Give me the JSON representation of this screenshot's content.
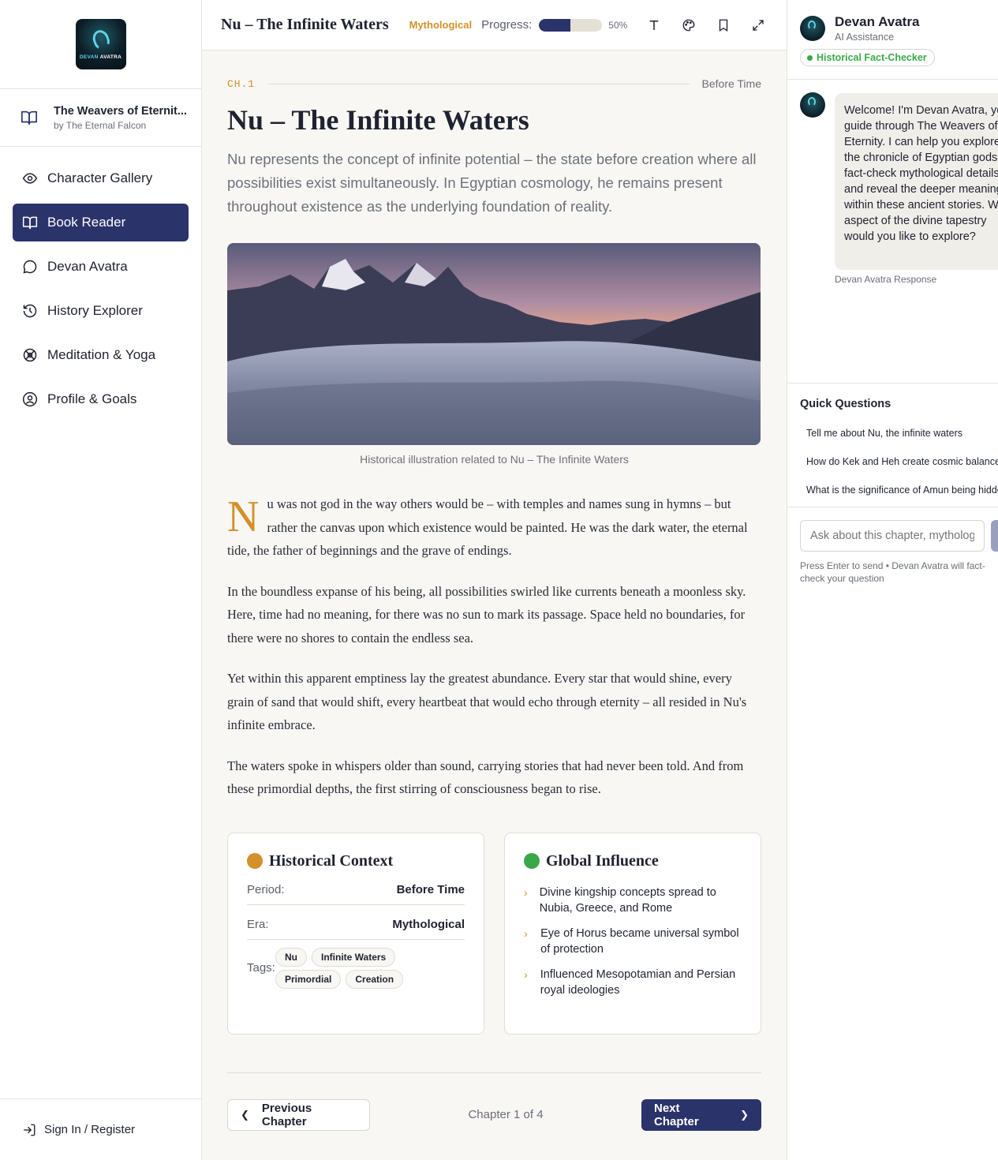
{
  "app": {
    "logo_text_a": "DEVAN",
    "logo_text_b": "AVATRA"
  },
  "sidebar": {
    "book_title": "The Weavers of Eternit...",
    "book_author": "by The Eternal Falcon",
    "items": [
      {
        "label": "Character Gallery",
        "icon": "eye-icon",
        "active": false
      },
      {
        "label": "Book Reader",
        "icon": "book-open-icon",
        "active": true
      },
      {
        "label": "Devan Avatra",
        "icon": "chat-bubble-icon",
        "active": false
      },
      {
        "label": "History Explorer",
        "icon": "history-icon",
        "active": false
      },
      {
        "label": "Meditation & Yoga",
        "icon": "lotus-icon",
        "active": false
      },
      {
        "label": "Profile & Goals",
        "icon": "user-circle-icon",
        "active": false
      }
    ],
    "sign_in": "Sign In / Register"
  },
  "topbar": {
    "title": "Nu – The Infinite Waters",
    "era": "Mythological",
    "progress_label": "Progress:",
    "progress_value": 0.5,
    "progress_pct": "50%",
    "tools": [
      "text-size-icon",
      "palette-icon",
      "bookmark-icon",
      "expand-icon"
    ]
  },
  "chapter": {
    "code": "CH.1",
    "period": "Before Time",
    "heading": "Nu – The Infinite Waters",
    "summary": "Nu represents the concept of infinite potential – the state before creation where all possibilities exist simultaneously. In Egyptian cosmology, he remains present throughout existence as the underlying foundation of reality.",
    "image_caption": "Historical illustration related to Nu – The Infinite Waters",
    "dropcap": "N",
    "paragraph_1": "u was not god in the way others would be – with temples and names sung in hymns – but rather the canvas upon which existence would be painted. He was the dark water, the eternal tide, the father of beginnings and the grave of endings.",
    "paragraph_2": "In the boundless expanse of his being, all possibilities swirled like currents beneath a moonless sky. Here, time had no meaning, for there was no sun to mark its passage. Space held no boundaries, for there were no shores to contain the endless sea.",
    "paragraph_3": "Yet within this apparent emptiness lay the greatest abundance. Every star that would shine, every grain of sand that would shift, every heartbeat that would echo through eternity – all resided in Nu's infinite embrace.",
    "paragraph_4": "The waters spoke in whispers older than sound, carrying stories that had never been told. And from these primordial depths, the first stirring of consciousness began to rise."
  },
  "context_card": {
    "title": "Historical Context",
    "dot_color": "#d4902a",
    "period_label": "Period:",
    "period_value": "Before Time",
    "era_label": "Era:",
    "era_value": "Mythological",
    "tags_label": "Tags:",
    "tags": [
      "Nu",
      "Infinite Waters",
      "Primordial",
      "Creation"
    ]
  },
  "influence_card": {
    "title": "Global Influence",
    "dot_color": "#3aa84a",
    "items": [
      "Divine kingship concepts spread to Nubia, Greece, and Rome",
      "Eye of Horus became universal symbol of protection",
      "Influenced Mesopotamian and Persian royal ideologies"
    ]
  },
  "chapter_nav": {
    "prev": "Previous Chapter",
    "count": "Chapter 1 of 4",
    "next": "Next Chapter"
  },
  "assistant": {
    "name": "Devan Avatra",
    "subtitle": "AI Assistance",
    "badge": "Historical Fact-Checker",
    "welcome": "Welcome! I'm Devan Avatra, your guide through The Weavers of Eternity. I can help you explore the chronicle of Egyptian gods, fact-check mythological details, and reveal the deeper meanings within these ancient stories. What aspect of the divine tapestry would you like to explore?",
    "response_meta": "Devan Avatra Response",
    "quick_title": "Quick Questions",
    "quick_questions": [
      "Tell me about Nu, the infinite waters",
      "How do Kek and Heh create cosmic balance?",
      "What is the significance of Amun being hidden?"
    ],
    "input_placeholder": "Ask about this chapter, mythology...",
    "hint": "Press Enter to send • Devan Avatra will fact-check your question"
  }
}
